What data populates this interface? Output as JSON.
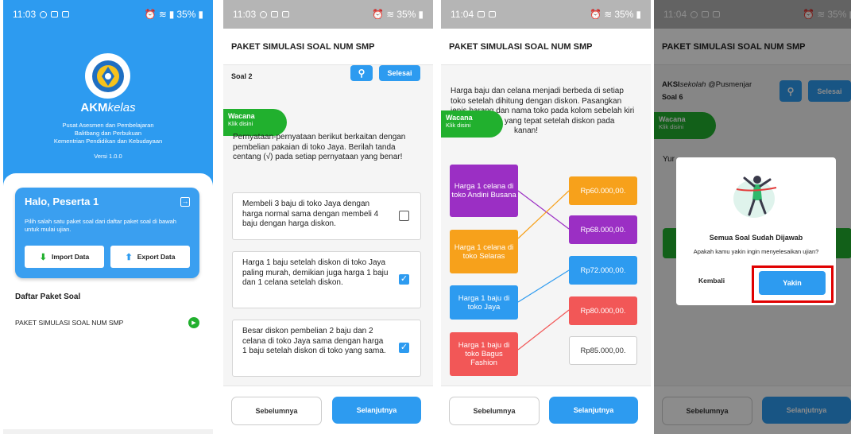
{
  "screen1": {
    "status": {
      "time": "11:03",
      "battery": "35%"
    },
    "logo_brand": "AKM",
    "logo_suffix": "kelas",
    "org_lines": [
      "Pusat Asesmen dan Pembelajaran",
      "Balitbang dan Perbukuan",
      "Kementrian Pendidikan dan Kebudayaan"
    ],
    "version": "Versi 1.0.0",
    "greeting": "Halo, Peserta 1",
    "instruction": "Pilih salah satu paket soal dari daftar paket soal di bawah untuk mulai ujian.",
    "import_label": "Import Data",
    "export_label": "Export Data",
    "list_title": "Daftar Paket Soal",
    "list_items": [
      "PAKET SIMULASI SOAL NUM SMP"
    ],
    "colors": {
      "primary": "#2d9bf0",
      "green": "#21b02e"
    }
  },
  "screen2": {
    "status": {
      "time": "11:03",
      "battery": "35%"
    },
    "title": "PAKET SIMULASI SOAL NUM SMP",
    "question_label": "Soal 2",
    "finish_label": "Selesai",
    "wacana_title": "Wacana",
    "wacana_sub": "Klik disini",
    "intro": "Pernyataan-pernyataan berikut berkaitan dengan pembelian pakaian di toko Jaya. Berilah tanda centang (√) pada setiap pernyataan yang benar!",
    "statements": [
      {
        "text": "Membeli 3 baju di toko Jaya dengan harga normal sama dengan membeli 4 baju dengan harga diskon.",
        "checked": false
      },
      {
        "text": "Harga 1 baju setelah diskon di toko Jaya paling murah, demikian juga harga 1 baju dan 1 celana setelah diskon.",
        "checked": true
      },
      {
        "text": "Besar diskon pembelian 2 baju dan 2 celana di toko Jaya sama dengan harga 1 baju setelah diskon di toko yang sama.",
        "checked": true
      }
    ],
    "prev_label": "Sebelumnya",
    "next_label": "Selanjutnya"
  },
  "screen3": {
    "status": {
      "time": "11:04",
      "battery": "35%"
    },
    "title": "PAKET SIMULASI SOAL NUM SMP",
    "intro_line1": "Harga baju dan celana menjadi berbeda di setiap",
    "intro_line2": "toko setelah dihitung dengan diskon. Pasangkan",
    "intro_line3": "jenis barang dan nama toko pada kolom sebelah kiri",
    "intro_line4": "yang tepat setelah diskon pada",
    "intro_line5": "kanan!",
    "wacana_title": "Wacana",
    "wacana_sub": "Klik disini",
    "left_items": [
      {
        "text": "Harga 1 celana di toko Andini Busana",
        "color": "#9b2fc4"
      },
      {
        "text": "Harga 1 celana di toko Selaras",
        "color": "#f7a11b"
      },
      {
        "text": "Harga 1 baju di toko Jaya",
        "color": "#2d9bf0"
      },
      {
        "text": "Harga 1 baju di toko Bagus Fashion",
        "color": "#f25757"
      }
    ],
    "right_items": [
      {
        "text": "Rp60.000,00.",
        "color": "#f7a11b"
      },
      {
        "text": "Rp68.000,00.",
        "color": "#9b2fc4"
      },
      {
        "text": "Rp72.000,00.",
        "color": "#2d9bf0"
      },
      {
        "text": "Rp80.000,00.",
        "color": "#f25757"
      },
      {
        "text": "Rp85.000,00.",
        "color": "#ffffff"
      }
    ],
    "prev_label": "Sebelumnya",
    "next_label": "Selanjutnya"
  },
  "screen4": {
    "status": {
      "time": "11:04",
      "battery": "35%"
    },
    "title": "PAKET SIMULASI SOAL NUM SMP",
    "author_prefix": "AKSI",
    "author_suffix": "sekolah",
    "author_handle": "@Pusmenjar",
    "question_label": "Soal 6",
    "finish_label": "Selesai",
    "wacana_title": "Wacana",
    "wacana_sub": "Klik disini",
    "bg_text": "Yur",
    "dialog_title": "Semua Soal Sudah Dijawab",
    "dialog_msg": "Apakah kamu yakin ingin menyelesaikan ujian?",
    "back_label": "Kembali",
    "confirm_label": "Yakin",
    "prev_label": "Sebelumnya",
    "next_label": "Selanjutnya",
    "highlight_color": "#e00000"
  }
}
